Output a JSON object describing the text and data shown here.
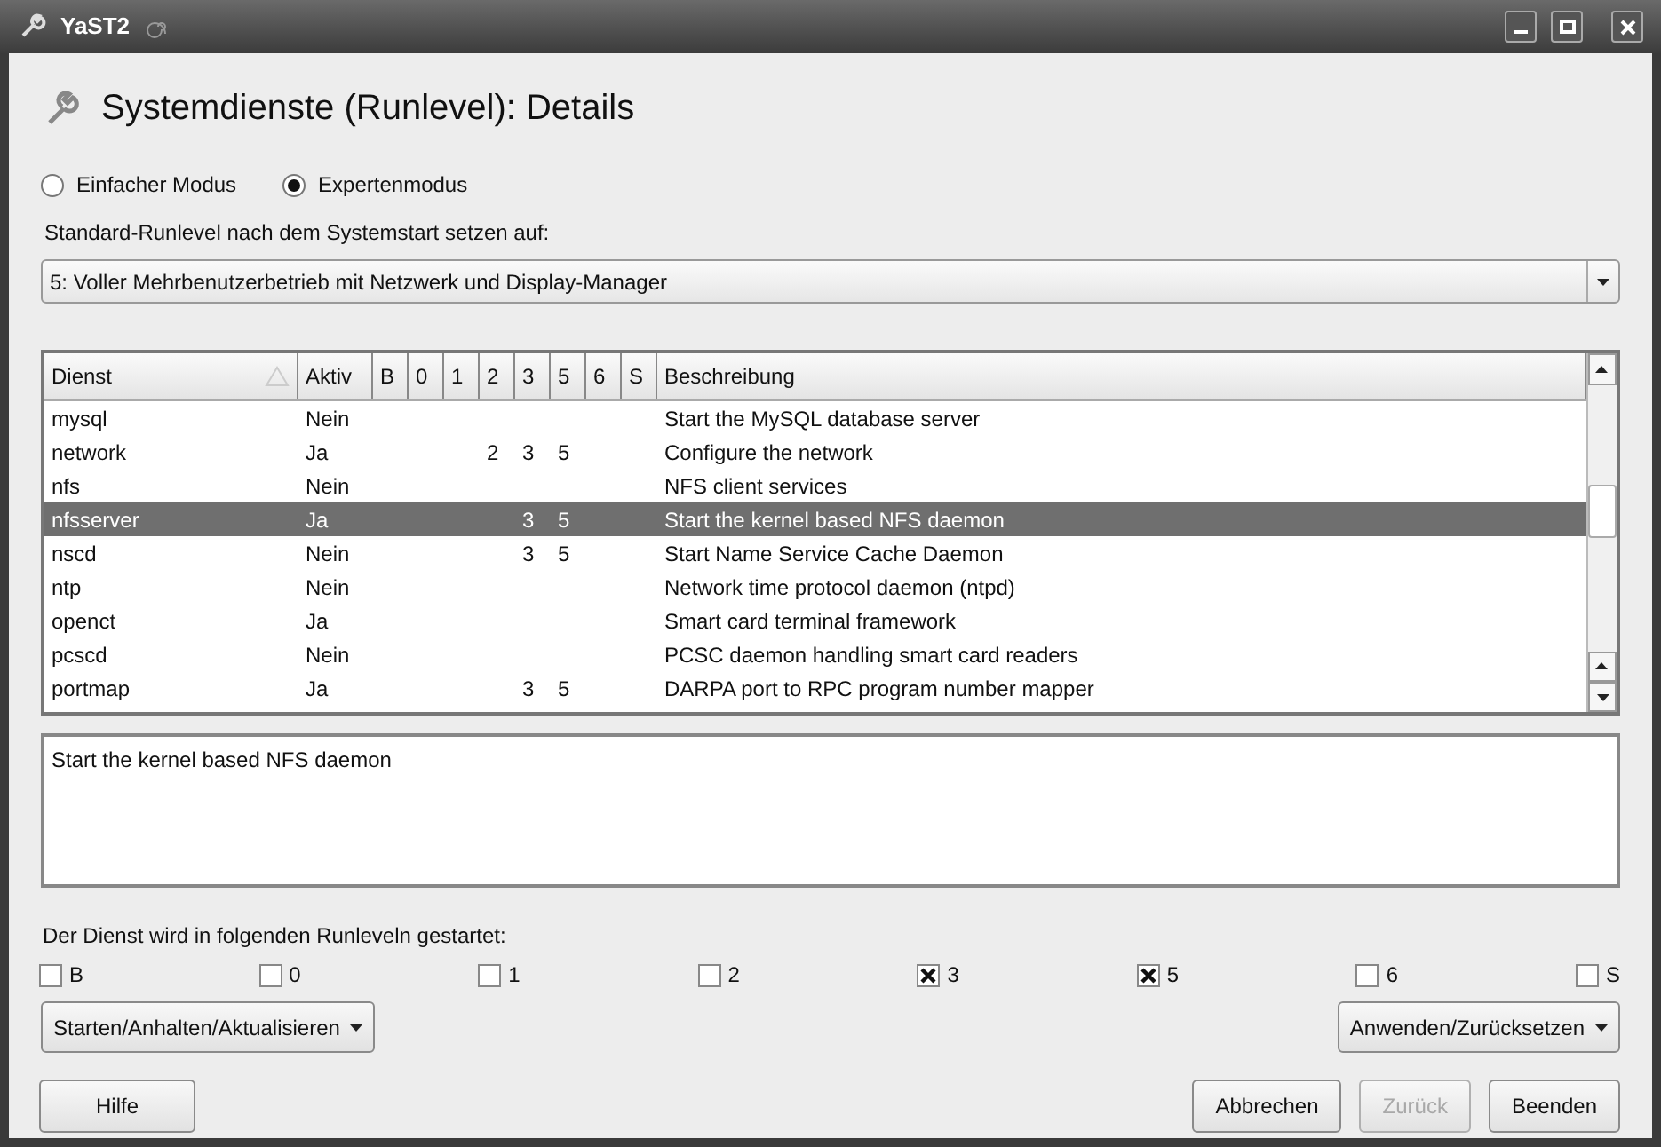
{
  "window": {
    "title": "YaST2"
  },
  "heading": "Systemdienste (Runlevel): Details",
  "modes": [
    {
      "label": "Einfacher Modus",
      "selected": false
    },
    {
      "label": "Expertenmodus",
      "selected": true
    }
  ],
  "default_runlevel": {
    "label": "Standard-Runlevel nach dem Systemstart setzen auf:",
    "value": "5: Voller Mehrbenutzerbetrieb mit Netzwerk und Display-Manager"
  },
  "table": {
    "columns": [
      {
        "label": "Dienst",
        "sorted": true
      },
      {
        "label": "Aktiv",
        "sorted": false
      },
      {
        "label": "B",
        "sorted": false
      },
      {
        "label": "0",
        "sorted": false
      },
      {
        "label": "1",
        "sorted": false
      },
      {
        "label": "2",
        "sorted": false
      },
      {
        "label": "3",
        "sorted": false
      },
      {
        "label": "5",
        "sorted": false
      },
      {
        "label": "6",
        "sorted": false
      },
      {
        "label": "S",
        "sorted": false
      },
      {
        "label": "Beschreibung",
        "sorted": false
      }
    ],
    "rows": [
      {
        "cells": [
          "mysql",
          "Nein",
          null,
          null,
          null,
          null,
          null,
          null,
          null,
          null,
          "Start the MySQL database server"
        ],
        "selected": false
      },
      {
        "cells": [
          "network",
          "Ja",
          null,
          null,
          null,
          "2",
          "3",
          "5",
          null,
          null,
          "Configure the network"
        ],
        "selected": false
      },
      {
        "cells": [
          "nfs",
          "Nein",
          null,
          null,
          null,
          null,
          null,
          null,
          null,
          null,
          "NFS client services"
        ],
        "selected": false
      },
      {
        "cells": [
          "nfsserver",
          "Ja",
          null,
          null,
          null,
          null,
          "3",
          "5",
          null,
          null,
          "Start the kernel based NFS daemon"
        ],
        "selected": true
      },
      {
        "cells": [
          "nscd",
          "Nein",
          null,
          null,
          null,
          null,
          "3",
          "5",
          null,
          null,
          "Start Name Service Cache Daemon"
        ],
        "selected": false
      },
      {
        "cells": [
          "ntp",
          "Nein",
          null,
          null,
          null,
          null,
          null,
          null,
          null,
          null,
          "Network time protocol daemon (ntpd)"
        ],
        "selected": false
      },
      {
        "cells": [
          "openct",
          "Ja",
          null,
          null,
          null,
          null,
          null,
          null,
          null,
          null,
          "Smart card terminal framework"
        ],
        "selected": false
      },
      {
        "cells": [
          "pcscd",
          "Nein",
          null,
          null,
          null,
          null,
          null,
          null,
          null,
          null,
          "PCSC daemon handling smart card readers"
        ],
        "selected": false
      },
      {
        "cells": [
          "portmap",
          "Ja",
          null,
          null,
          null,
          null,
          "3",
          "5",
          null,
          null,
          "DARPA port to RPC program number mapper"
        ],
        "selected": false
      }
    ]
  },
  "details": "Start the kernel based NFS daemon",
  "runlevels_label": "Der Dienst wird in folgenden Runleveln gestartet:",
  "runlevels": [
    {
      "label": "B",
      "checked": false
    },
    {
      "label": "0",
      "checked": false
    },
    {
      "label": "1",
      "checked": false
    },
    {
      "label": "2",
      "checked": false
    },
    {
      "label": "3",
      "checked": true
    },
    {
      "label": "5",
      "checked": true
    },
    {
      "label": "6",
      "checked": false
    },
    {
      "label": "S",
      "checked": false
    }
  ],
  "menu_buttons": [
    {
      "label": "Starten/Anhalten/Aktualisieren"
    },
    {
      "label": "Anwenden/Zurücksetzen"
    }
  ],
  "buttons": [
    {
      "label": "Hilfe",
      "disabled": false
    },
    {
      "label": "Abbrechen",
      "disabled": false
    },
    {
      "label": "Zurück",
      "disabled": true
    },
    {
      "label": "Beenden",
      "disabled": false
    }
  ]
}
